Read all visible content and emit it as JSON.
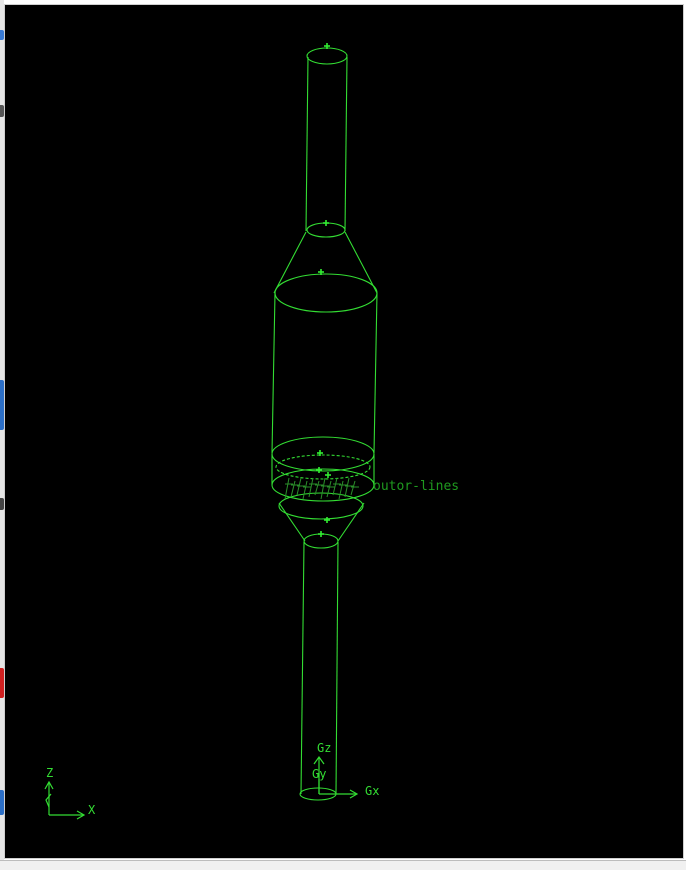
{
  "viewport": {
    "background": "#000000",
    "wire_color": "#33dd33",
    "label_color": "#1f9a1f",
    "axis_color": "#33dd33"
  },
  "model": {
    "label": "outor-lines"
  },
  "global_axes": {
    "z_label": "Gz",
    "y_label": "Gy",
    "x_label": "Gx"
  },
  "view_triad": {
    "z_label": "Z",
    "x_label": "X"
  },
  "icons": {
    "triad": "view-orientation-triad-icon",
    "global_axes": "global-coordinate-axes-icon"
  }
}
